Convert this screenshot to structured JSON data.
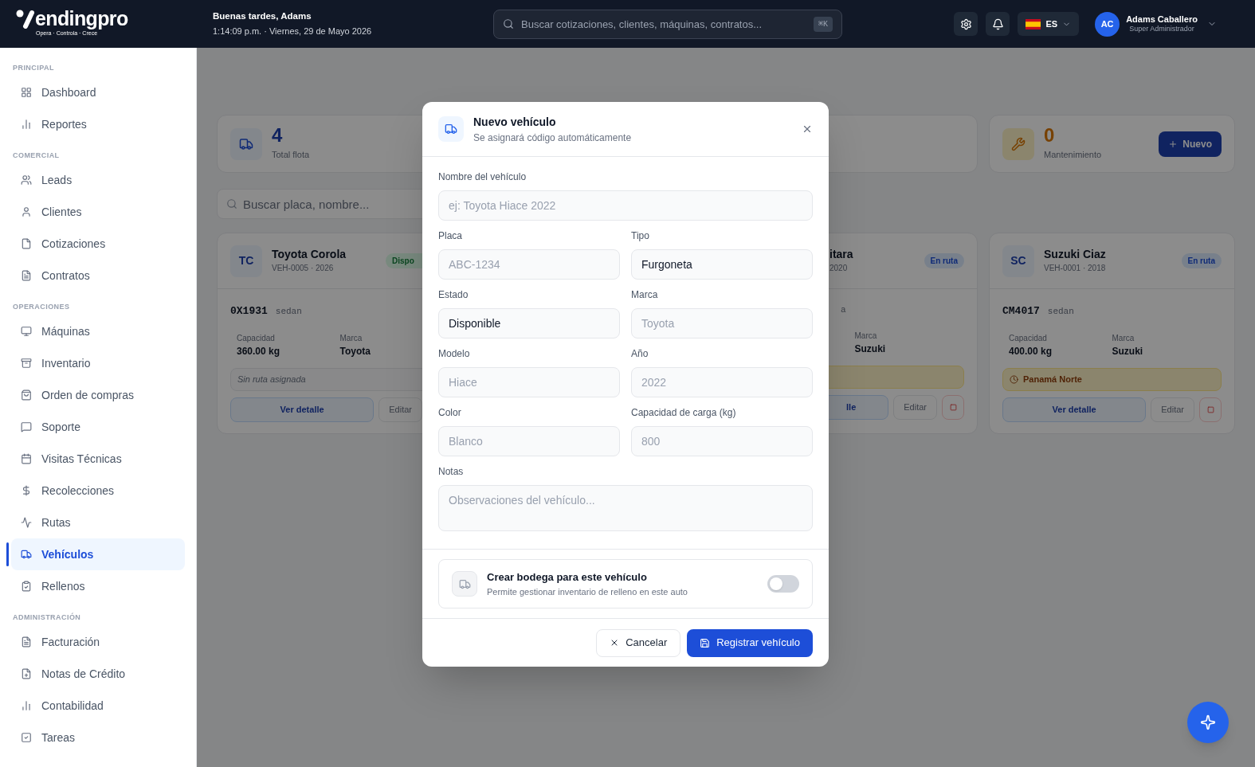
{
  "header": {
    "logo": {
      "wordmark": "endingpro",
      "tagline": "Opera · Controla · Crece"
    },
    "greeting": "Buenas tardes, Adams",
    "datetime": "1:14:09 p.m. · Viernes, 29 de Mayo 2026",
    "search": {
      "placeholder": "Buscar cotizaciones, clientes, máquinas, contratos...",
      "shortcut": "⌘K"
    },
    "language": "ES",
    "user": {
      "initials": "AC",
      "name": "Adams Caballero",
      "role": "Super Administrador"
    }
  },
  "sidebar": {
    "sections": [
      {
        "title": "PRINCIPAL",
        "items": [
          {
            "label": "Dashboard",
            "selected": false
          },
          {
            "label": "Reportes",
            "selected": false
          }
        ]
      },
      {
        "title": "COMERCIAL",
        "items": [
          {
            "label": "Leads",
            "selected": false
          },
          {
            "label": "Clientes",
            "selected": false
          },
          {
            "label": "Cotizaciones",
            "selected": false
          },
          {
            "label": "Contratos",
            "selected": false
          }
        ]
      },
      {
        "title": "OPERACIONES",
        "items": [
          {
            "label": "Máquinas",
            "selected": false
          },
          {
            "label": "Inventario",
            "selected": false
          },
          {
            "label": "Orden de compras",
            "selected": false
          },
          {
            "label": "Soporte",
            "selected": false
          },
          {
            "label": "Visitas Técnicas",
            "selected": false
          },
          {
            "label": "Recolecciones",
            "selected": false
          },
          {
            "label": "Rutas",
            "selected": false
          },
          {
            "label": "Vehículos",
            "selected": true
          },
          {
            "label": "Rellenos",
            "selected": false
          }
        ]
      },
      {
        "title": "ADMINISTRACIÓN",
        "items": [
          {
            "label": "Facturación",
            "selected": false
          },
          {
            "label": "Notas de Crédito",
            "selected": false
          },
          {
            "label": "Contabilidad",
            "selected": false
          },
          {
            "label": "Tareas",
            "selected": false
          }
        ]
      }
    ]
  },
  "stats": [
    {
      "kind": "fleet",
      "value": "4",
      "label": "Total flota"
    },
    {
      "kind": "covered"
    },
    {
      "kind": "blank"
    },
    {
      "kind": "maintenance",
      "value": "0",
      "label": "Mantenimiento",
      "button": "Nuevo"
    }
  ],
  "search": {
    "placeholder": "Buscar placa, nombre..."
  },
  "vehicles": [
    {
      "kind": "clipped_right",
      "initials": "TC",
      "name": "Toyota Corola",
      "meta": "VEH-0005 · 2026",
      "status": "Dispo",
      "available": true,
      "plate": "0X1931",
      "type": "sedan",
      "capacity_label": "Capacidad",
      "capacity": "360.00 kg",
      "brand_label": "Marca",
      "brand": "Toyota",
      "route": {
        "assigned": false,
        "text": "Sin ruta asignada"
      },
      "detail": "Ver detalle",
      "edit": "Editar"
    },
    {
      "kind": "hidden"
    },
    {
      "kind": "partial",
      "name": "itara",
      "meta": "2020",
      "status": "En ruta",
      "available": false,
      "type": "a",
      "brand_label": "Marca",
      "brand": "Suzuki",
      "route": {
        "assigned": true
      },
      "detail": "lle",
      "edit": "Editar"
    },
    {
      "kind": "full",
      "initials": "SC",
      "name": "Suzuki Ciaz",
      "meta": "VEH-0001 · 2018",
      "status": "En ruta",
      "available": false,
      "plate": "CM4017",
      "type": "sedan",
      "capacity_label": "Capacidad",
      "capacity": "400.00 kg",
      "brand_label": "Marca",
      "brand": "Suzuki",
      "route": {
        "assigned": true,
        "text": "Panamá Norte"
      },
      "detail": "Ver detalle",
      "edit": "Editar"
    }
  ],
  "modal": {
    "title": "Nuevo vehículo",
    "subtitle": "Se asignará código automáticamente",
    "fields": [
      {
        "kind": "text",
        "wide": true,
        "label": "Nombre del vehículo",
        "placeholder": "ej: Toyota Hiace 2022"
      },
      {
        "kind": "text",
        "wide": false,
        "label": "Placa",
        "placeholder": "ABC-1234"
      },
      {
        "kind": "select",
        "wide": false,
        "label": "Tipo",
        "value": "Furgoneta"
      },
      {
        "kind": "select",
        "wide": false,
        "label": "Estado",
        "value": "Disponible"
      },
      {
        "kind": "text",
        "wide": false,
        "label": "Marca",
        "placeholder": "Toyota"
      },
      {
        "kind": "text",
        "wide": false,
        "label": "Modelo",
        "placeholder": "Hiace"
      },
      {
        "kind": "text",
        "wide": false,
        "label": "Año",
        "placeholder": "2022"
      },
      {
        "kind": "text",
        "wide": false,
        "label": "Color",
        "placeholder": "Blanco"
      },
      {
        "kind": "text",
        "wide": false,
        "label": "Capacidad de carga (kg)",
        "placeholder": "800"
      },
      {
        "kind": "textarea",
        "wide": true,
        "label": "Notas",
        "placeholder": "Observaciones del vehículo..."
      }
    ],
    "warehouse": {
      "title": "Crear bodega para este vehículo",
      "description": "Permite gestionar inventario de relleno en este auto",
      "on": false
    },
    "cancel": "Cancelar",
    "submit": "Registrar vehículo"
  }
}
